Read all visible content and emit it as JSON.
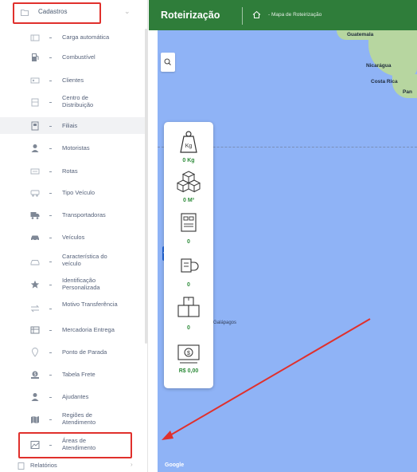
{
  "sidebar": {
    "header_label": "Cadastros",
    "items": [
      {
        "label": "Carga automática",
        "icon": "cargo-icon"
      },
      {
        "label": "Combustível",
        "icon": "fuel-icon"
      },
      {
        "label": "Clientes",
        "icon": "clients-icon"
      },
      {
        "label": "Centro de Distribuição",
        "icon": "warehouse-icon"
      },
      {
        "label": "Filiais",
        "icon": "branches-icon"
      },
      {
        "label": "Motoristas",
        "icon": "driver-icon"
      },
      {
        "label": "Rotas",
        "icon": "route-icon"
      },
      {
        "label": "Tipo Veículo",
        "icon": "vehicle-type-icon"
      },
      {
        "label": "Transportadoras",
        "icon": "truck-icon"
      },
      {
        "label": "Veículos",
        "icon": "car-icon"
      },
      {
        "label": "Característica do veículo",
        "icon": "vehicle-feature-icon"
      },
      {
        "label": "Identificação Personalizada",
        "icon": "star-icon"
      },
      {
        "label": "Motivo Transferência",
        "icon": "transfer-icon"
      },
      {
        "label": "Mercadoria Entrega",
        "icon": "merchandise-icon"
      },
      {
        "label": "Ponto de Parada",
        "icon": "stop-point-icon"
      },
      {
        "label": "Tabela Frete",
        "icon": "freight-table-icon"
      },
      {
        "label": "Ajudantes",
        "icon": "helpers-icon"
      },
      {
        "label": "Regiões de Atendimento",
        "icon": "regions-icon"
      },
      {
        "label": "Áreas de Atendimento",
        "icon": "areas-icon"
      }
    ],
    "footer_label": "Relatórios"
  },
  "header": {
    "title": "Roteirização",
    "breadcrumb": "- Mapa de Roteirização"
  },
  "map": {
    "places": [
      "Guatemala",
      "Nicarágua",
      "Costa Rica",
      "Pan",
      "Galápagos"
    ],
    "attribution": "Google"
  },
  "cargo_panel": {
    "weight": "0 Kg",
    "volume": "0 M³",
    "packages": "0",
    "deliveries": "0",
    "boxes": "0",
    "value": "R$ 0,00"
  },
  "colors": {
    "header_bg": "#2f7d3a",
    "accent_green": "#2e8b3a",
    "highlight_red": "#e0302c",
    "ocean": "#8fb3f6"
  }
}
